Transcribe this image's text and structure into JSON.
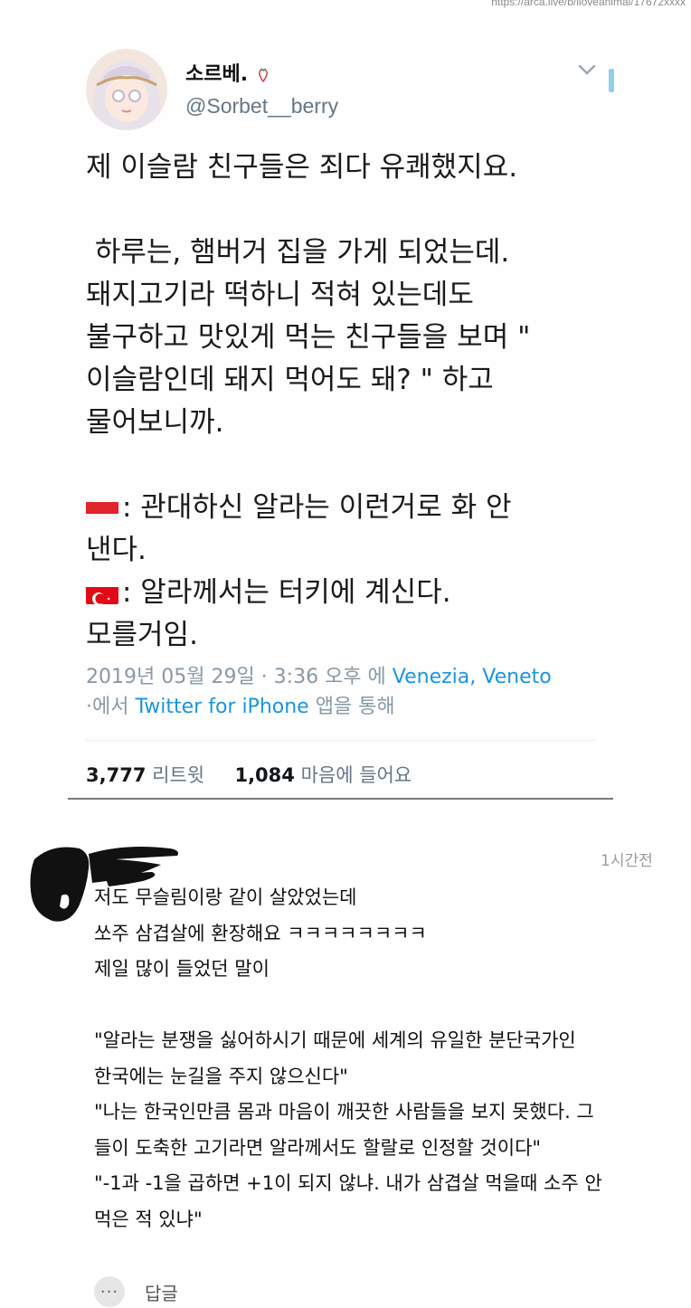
{
  "source_url": "https://arca.live/b/iloveanimal/17672xxxx",
  "tweet": {
    "display_name": "소르베.",
    "handle": "@Sorbet__berry",
    "lines": [
      "제 이슬람 친구들은 죄다 유쾌했지요.",
      "",
      " 하루는, 햄버거 집을 가게 되었는데.",
      "돼지고기라 떡하니 적혀 있는데도",
      "불구하고 맛있게 먹는 친구들을 보며 \"",
      "이슬람인데 돼지 먹어도 돼? \" 하고",
      "물어보니까.",
      ""
    ],
    "flag_lines": [
      {
        "flag": "indonesia-flag",
        "text": ": 관대하신 알라는 이런거로 화 안"
      },
      {
        "flag": "",
        "text": "낸다."
      },
      {
        "flag": "turkey-flag",
        "text": ": 알라께서는 터키에 계신다."
      },
      {
        "flag": "",
        "text": "모를거임."
      }
    ],
    "meta": {
      "date": "2019년 05월 29일 · 3:36 오후 에 ",
      "location": "Venezia, Veneto",
      "via_prefix": "·에서 ",
      "client": "Twitter for iPhone",
      "via_suffix": " 앱을 통해"
    },
    "stats": {
      "retweets": "3,777",
      "retweets_label": "리트윗",
      "likes": "1,084",
      "likes_label": "마음에 들어요"
    }
  },
  "comment": {
    "time": "1시간전",
    "lines": [
      "저도 무슬림이랑 같이 살았었는데",
      "쏘주 삼겹살에 환장해요 ㅋㅋㅋㅋㅋㅋㅋㅋ",
      "제일 많이 들었던 말이",
      "",
      "\"알라는 분쟁을 싫어하시기 때문에 세계의 유일한 분단국가인",
      "한국에는 눈길을 주지 않으신다\"",
      "\"나는 한국인만큼 몸과 마음이 깨끗한 사람들을 보지 못했다. 그",
      "들이 도축한 고기라면 알라께서도 할랄로 인정할 것이다\"",
      "\"-1과 -1을 곱하면 +1이 되지 않냐. 내가 삼겹살 먹을때 소주 안",
      "먹은 적 있냐\""
    ],
    "more_label": "···",
    "reply_label": "답글"
  },
  "colors": {
    "link": "#1b95e0",
    "muted": "#8899a6",
    "divider": "#7a7a7a"
  }
}
